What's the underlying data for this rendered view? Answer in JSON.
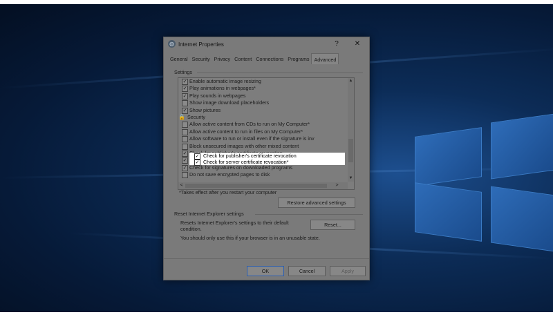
{
  "dialog": {
    "title": "Internet Properties",
    "help_glyph": "?",
    "close_glyph": "✕",
    "icon_glyph": "◍"
  },
  "tabs": [
    {
      "label": "General"
    },
    {
      "label": "Security"
    },
    {
      "label": "Privacy"
    },
    {
      "label": "Content"
    },
    {
      "label": "Connections"
    },
    {
      "label": "Programs"
    },
    {
      "label": "Advanced",
      "active": true
    }
  ],
  "settings": {
    "group_label": "Settings",
    "rows": [
      {
        "label": "Enable automatic image resizing",
        "checked": true
      },
      {
        "label": "Play animations in webpages*",
        "checked": true
      },
      {
        "label": "Play sounds in webpages",
        "checked": true
      },
      {
        "label": "Show image download placeholders",
        "checked": false
      },
      {
        "label": "Show pictures",
        "checked": true
      },
      {
        "label": "Security",
        "category": true
      },
      {
        "label": "Allow active content from CDs to run on My Computer*",
        "checked": false
      },
      {
        "label": "Allow active content to run in files on My Computer*",
        "checked": false
      },
      {
        "label": "Allow software to run or install even if the signature is inv",
        "checked": false
      },
      {
        "label": "Block unsecured images with other mixed content",
        "checked": false
      },
      {
        "label": "Check for publisher's certificate revocation",
        "checked": true
      },
      {
        "label": "Check for server certificate revocation*",
        "checked": true
      },
      {
        "label": "Check for signatures on downloaded programs",
        "checked": true
      },
      {
        "label": "Do not save encrypted pages to disk",
        "checked": false
      }
    ],
    "footnote": "*Takes effect after you restart your computer",
    "restore_button": "Restore advanced settings"
  },
  "reset": {
    "group_label": "Reset Internet Explorer settings",
    "description_line1": "Resets Internet Explorer's settings to their default",
    "description_line2": "condition.",
    "reset_button": "Reset...",
    "warning": "You should only use this if your browser is in an unusable state."
  },
  "footer": {
    "ok": "OK",
    "cancel": "Cancel",
    "apply": "Apply"
  },
  "glyphs": {
    "check": "✓",
    "lock": "🔒",
    "up": "▲",
    "down": "▼",
    "left": "<",
    "right": ">"
  }
}
